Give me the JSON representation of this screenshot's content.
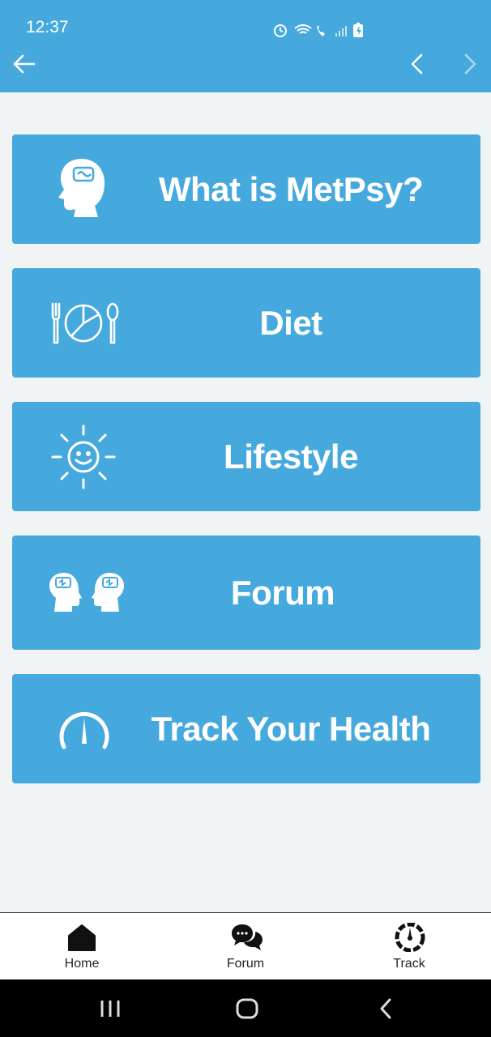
{
  "status_bar": {
    "time": "12:37"
  },
  "colors": {
    "primary": "#46a9de",
    "background": "#f1f4f5",
    "white": "#ffffff"
  },
  "header": {
    "back_icon": "arrow-left-icon",
    "prev_icon": "chevron-left-icon",
    "next_icon": "chevron-right-icon"
  },
  "menu": [
    {
      "label": "What is MetPsy?",
      "icon": "brain-head-icon"
    },
    {
      "label": "Diet",
      "icon": "fork-plate-spoon-icon"
    },
    {
      "label": "Lifestyle",
      "icon": "smiling-sun-icon"
    },
    {
      "label": "Forum",
      "icon": "two-heads-icon"
    },
    {
      "label": "Track Your Health",
      "icon": "gauge-icon"
    }
  ],
  "bottom_nav": [
    {
      "label": "Home",
      "icon": "home-icon"
    },
    {
      "label": "Forum",
      "icon": "chat-bubbles-icon"
    },
    {
      "label": "Track",
      "icon": "speedometer-icon"
    }
  ],
  "system_nav": [
    "recents-icon",
    "home-circle-icon",
    "back-chevron-icon"
  ]
}
